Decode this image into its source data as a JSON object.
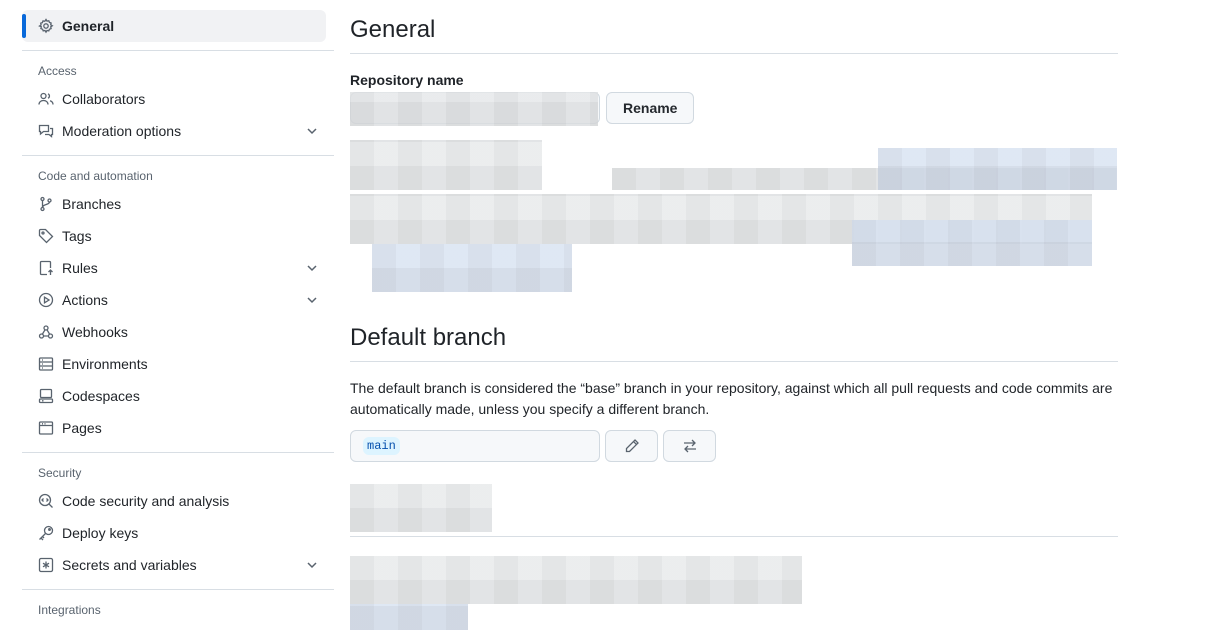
{
  "sidebar": {
    "general": "General",
    "sections": [
      {
        "title": "Access",
        "items": [
          {
            "label": "Collaborators",
            "icon": "people-icon",
            "chevron": false
          },
          {
            "label": "Moderation options",
            "icon": "comment-discussion-icon",
            "chevron": true
          }
        ]
      },
      {
        "title": "Code and automation",
        "items": [
          {
            "label": "Branches",
            "icon": "git-branch-icon",
            "chevron": false
          },
          {
            "label": "Tags",
            "icon": "tag-icon",
            "chevron": false
          },
          {
            "label": "Rules",
            "icon": "repo-push-icon",
            "chevron": true
          },
          {
            "label": "Actions",
            "icon": "play-icon",
            "chevron": true
          },
          {
            "label": "Webhooks",
            "icon": "webhook-icon",
            "chevron": false
          },
          {
            "label": "Environments",
            "icon": "server-icon",
            "chevron": false
          },
          {
            "label": "Codespaces",
            "icon": "codespaces-icon",
            "chevron": false
          },
          {
            "label": "Pages",
            "icon": "browser-icon",
            "chevron": false
          }
        ]
      },
      {
        "title": "Security",
        "items": [
          {
            "label": "Code security and analysis",
            "icon": "codescan-icon",
            "chevron": false
          },
          {
            "label": "Deploy keys",
            "icon": "key-icon",
            "chevron": false
          },
          {
            "label": "Secrets and variables",
            "icon": "asterisk-icon",
            "chevron": true
          }
        ]
      },
      {
        "title": "Integrations",
        "items": []
      }
    ]
  },
  "main": {
    "title": "General",
    "repo_name_label": "Repository name",
    "rename_button": "Rename",
    "default_branch_title": "Default branch",
    "default_branch_desc": "The default branch is considered the “base” branch in your repository, against which all pull requests and code commits are automatically made, unless you specify a different branch.",
    "branch_name": "main",
    "edit_icon": "pencil-icon",
    "switch_icon": "arrow-switch-icon"
  }
}
